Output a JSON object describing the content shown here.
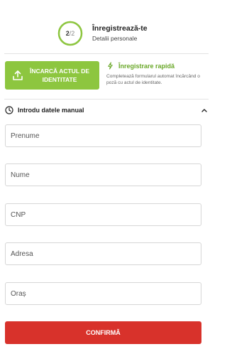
{
  "header": {
    "step_current": "2",
    "step_separator": "/",
    "step_total": "2",
    "title": "Înregistrează-te",
    "subtitle": "Detalii personale",
    "progress_fraction": 1.0
  },
  "upload": {
    "label": "ÎNCARCĂ ACTUL DE IDENTITATE",
    "icon": "upload-icon"
  },
  "quick_register": {
    "title": "Înregistrare rapidă",
    "description": "Completează formularul automat încărcând o poză cu actul de identitate.",
    "icon": "lightning-icon"
  },
  "manual": {
    "label": "Introdu datele manual",
    "icon": "clock-icon",
    "toggle_icon": "chevron-up-icon"
  },
  "form": {
    "first_name_placeholder": "Prenume",
    "last_name_placeholder": "Nume",
    "cnp_placeholder": "CNP",
    "address_placeholder": "Adresa",
    "city_placeholder": "Oraș"
  },
  "confirm_label": "CONFIRMĂ",
  "colors": {
    "accent_green": "#8dc63f",
    "link_green": "#6aa829",
    "confirm_red": "#d8322b",
    "border": "#d6d6d6"
  }
}
